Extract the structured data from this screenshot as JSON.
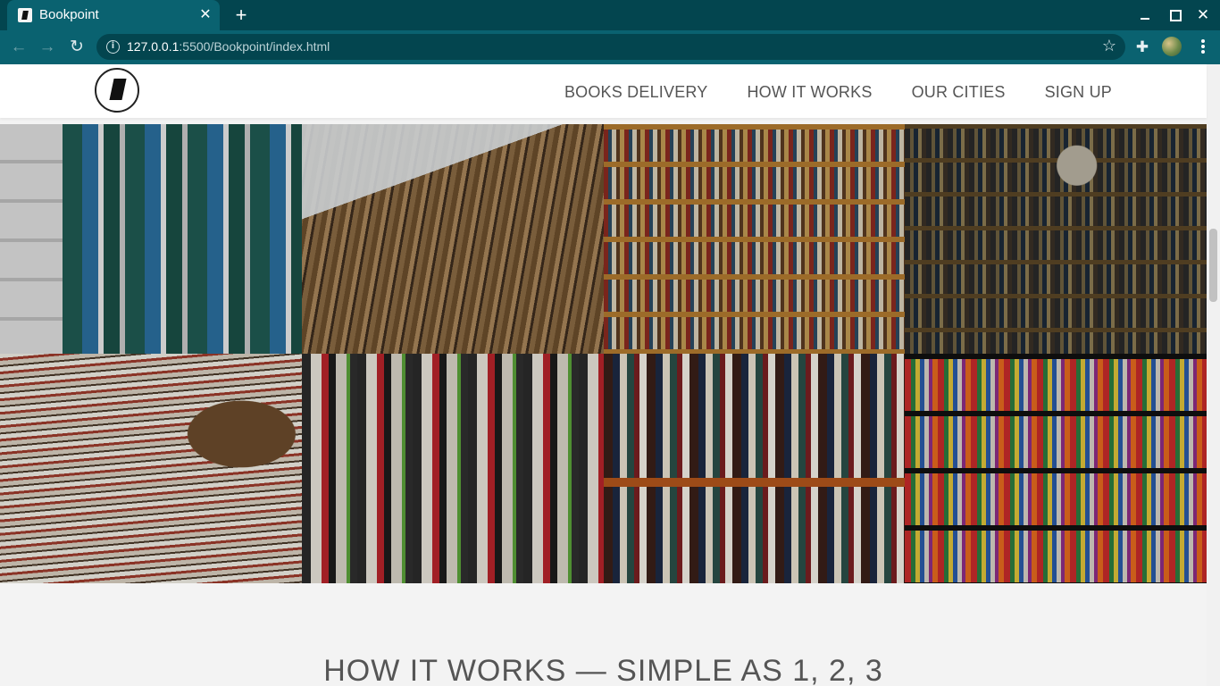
{
  "browser": {
    "tab_title": "Bookpoint",
    "tab_close_glyph": "✕",
    "new_tab_glyph": "+",
    "url_host": "127.0.0.1",
    "url_rest": ":5500/Bookpoint/index.html",
    "back_glyph": "←",
    "forward_glyph": "→",
    "reload_glyph": "↻",
    "info_glyph": "i",
    "star_glyph": "☆",
    "extensions_glyph": "✚",
    "close_glyph": "✕",
    "icons": [
      "back-icon",
      "forward-icon",
      "reload-icon",
      "info-icon",
      "star-icon",
      "extensions-icon",
      "profile-avatar",
      "menu-icon"
    ]
  },
  "site": {
    "nav": {
      "items": [
        {
          "label": "BOOKS DELIVERY"
        },
        {
          "label": "HOW IT WORKS"
        },
        {
          "label": "OUR CITIES"
        },
        {
          "label": "SIGN UP"
        }
      ]
    },
    "gallery": {
      "photos": [
        "bookshelf-binders",
        "library-aisle",
        "wooden-bookshelves",
        "antique-bookstore",
        "book-market-stacks",
        "shelf-spines",
        "leather-books-shelf",
        "colorful-bookshelf"
      ]
    },
    "section_title": "HOW IT WORKS — SIMPLE AS 1, 2, 3"
  }
}
